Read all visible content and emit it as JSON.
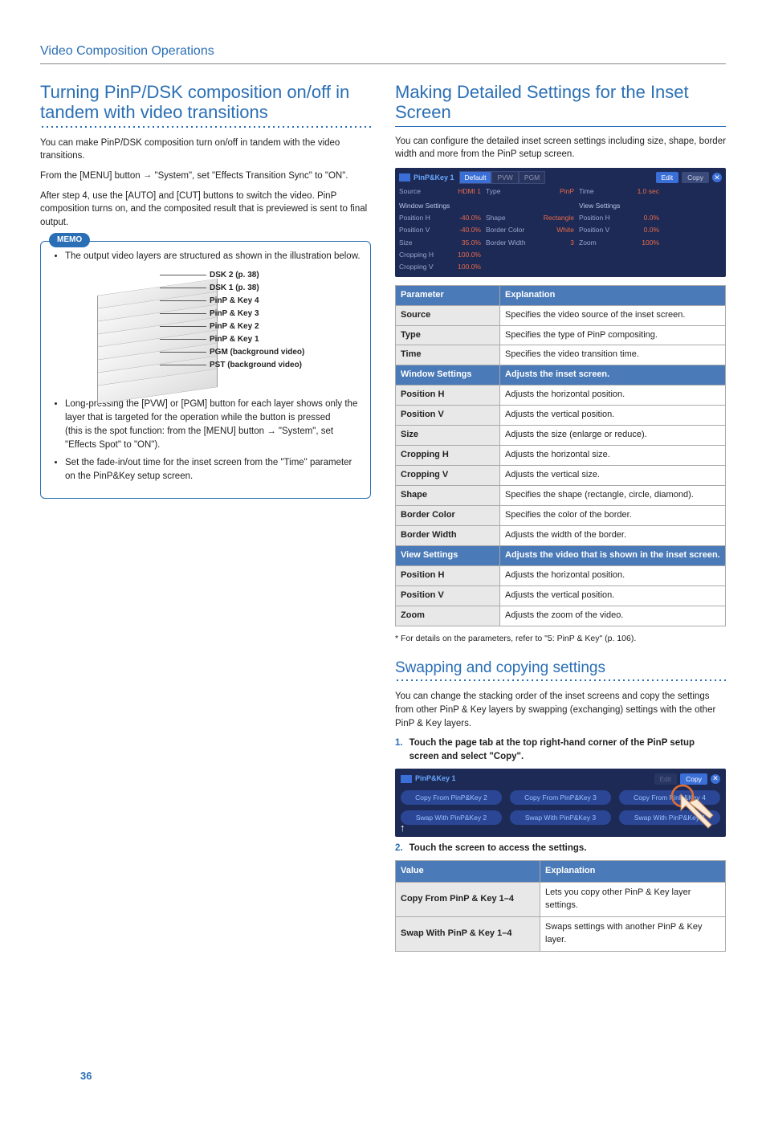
{
  "header": {
    "breadcrumb": "Video Composition Operations"
  },
  "left": {
    "title": "Turning PinP/DSK composition on/off in tandem with video transitions",
    "p1": "You can make PinP/DSK composition turn on/off in tandem with the video transitions.",
    "p2a": "From the [MENU] button ",
    "p2b": " \"System\", set \"Effects Transition Sync\" to \"ON\".",
    "p3": "After step 4, use the [AUTO] and [CUT] buttons to switch the video. PinP composition turns on, and the composited result that is previewed is sent to final output.",
    "memo_label": "MEMO",
    "memo_b1": "The output video layers are structured as shown in the illustration below.",
    "layers": [
      "DSK 2 (p. 38)",
      "DSK 1 (p. 38)",
      "PinP & Key 4",
      "PinP & Key 3",
      "PinP & Key 2",
      "PinP & Key 1",
      "PGM (background video)",
      "PST (background video)"
    ],
    "memo_b2": "Long-pressing the [PVW] or [PGM] button for each layer shows only the layer that is targeted for the operation while the button is pressed",
    "memo_b2b": "(this is the spot function: from the [MENU] button → \"System\", set \"Effects Spot\" to \"ON\").",
    "memo_b3": "Set the fade-in/out time for the inset screen from the \"Time\" parameter on the PinP&Key setup screen."
  },
  "right": {
    "title": "Making Detailed Settings for the Inset Screen",
    "intro": "You can configure the detailed inset screen settings including size, shape, border width and more from the PinP setup screen.",
    "ui": {
      "title": "PinP&Key 1",
      "tab_default": "Default",
      "tab_pvw": "PVW",
      "tab_pgm": "PGM",
      "btn_edit": "Edit",
      "btn_copy": "Copy",
      "row1": [
        "Source",
        "HDMI 1",
        "Type",
        "PinP",
        "Time",
        "1.0 sec"
      ],
      "hdr_win": "Window Settings",
      "hdr_view": "View Settings",
      "r2": [
        "Position H",
        "-40.0%",
        "Shape",
        "Rectangle",
        "Position H",
        "0.0%"
      ],
      "r3": [
        "Position V",
        "-40.0%",
        "Border Color",
        "White",
        "Position V",
        "0.0%"
      ],
      "r4": [
        "Size",
        "35.0%",
        "Border Width",
        "3",
        "Zoom",
        "100%"
      ],
      "r5": [
        "Cropping H",
        "100.0%"
      ],
      "r6": [
        "Cropping V",
        "100.0%"
      ]
    },
    "param_hdr": [
      "Parameter",
      "Explanation"
    ],
    "params": [
      {
        "p": "Source",
        "e": "Specifies the video source of the inset screen."
      },
      {
        "p": "Type",
        "e": "Specifies the type of PinP compositing."
      },
      {
        "p": "Time",
        "e": "Specifies the video transition time."
      },
      {
        "sect": "Window Settings",
        "e": "Adjusts the inset screen."
      },
      {
        "p": "Position H",
        "e": "Adjusts the horizontal position."
      },
      {
        "p": "Position V",
        "e": "Adjusts the vertical position."
      },
      {
        "p": "Size",
        "e": "Adjusts the size (enlarge or reduce)."
      },
      {
        "p": "Cropping H",
        "e": "Adjusts the horizontal size."
      },
      {
        "p": "Cropping V",
        "e": "Adjusts the vertical size."
      },
      {
        "p": "Shape",
        "e": "Specifies the shape (rectangle, circle, diamond)."
      },
      {
        "p": "Border Color",
        "e": "Specifies the color of the border."
      },
      {
        "p": "Border Width",
        "e": "Adjusts the width of the border."
      },
      {
        "sect": "View Settings",
        "e": "Adjusts the video that is shown in the inset screen."
      },
      {
        "p": "Position H",
        "e": "Adjusts the horizontal position."
      },
      {
        "p": "Position V",
        "e": "Adjusts the vertical position."
      },
      {
        "p": "Zoom",
        "e": "Adjusts the zoom of the video."
      }
    ],
    "footnote": "* For details on the parameters, refer to \"5: PinP & Key\" (p. 106).",
    "swap_title": "Swapping and copying settings",
    "swap_intro": "You can change the stacking order of the inset screens and copy the settings from other PinP & Key layers by swapping (exchanging) settings with the other PinP & Key layers.",
    "step1_num": "1.",
    "step1": "Touch the page tab at the top right-hand corner of the PinP setup screen and select \"Copy\".",
    "ui2": {
      "title": "PinP&Key 1",
      "btn_edit": "Edit",
      "btn_copy": "Copy",
      "copy": [
        "Copy From PinP&Key 2",
        "Copy From PinP&Key 3",
        "Copy From PinP&Key 4"
      ],
      "swap": [
        "Swap With PinP&Key 2",
        "Swap With PinP&Key 3",
        "Swap With PinP&Key 4"
      ]
    },
    "step2_num": "2.",
    "step2": "Touch the screen to access the settings.",
    "val_hdr": [
      "Value",
      "Explanation"
    ],
    "vals": [
      {
        "v": "Copy From PinP & Key 1–4",
        "e": "Lets you copy other PinP & Key layer settings."
      },
      {
        "v": "Swap With PinP & Key 1–4",
        "e": "Swaps settings with another PinP & Key layer."
      }
    ]
  },
  "page_num": "36"
}
